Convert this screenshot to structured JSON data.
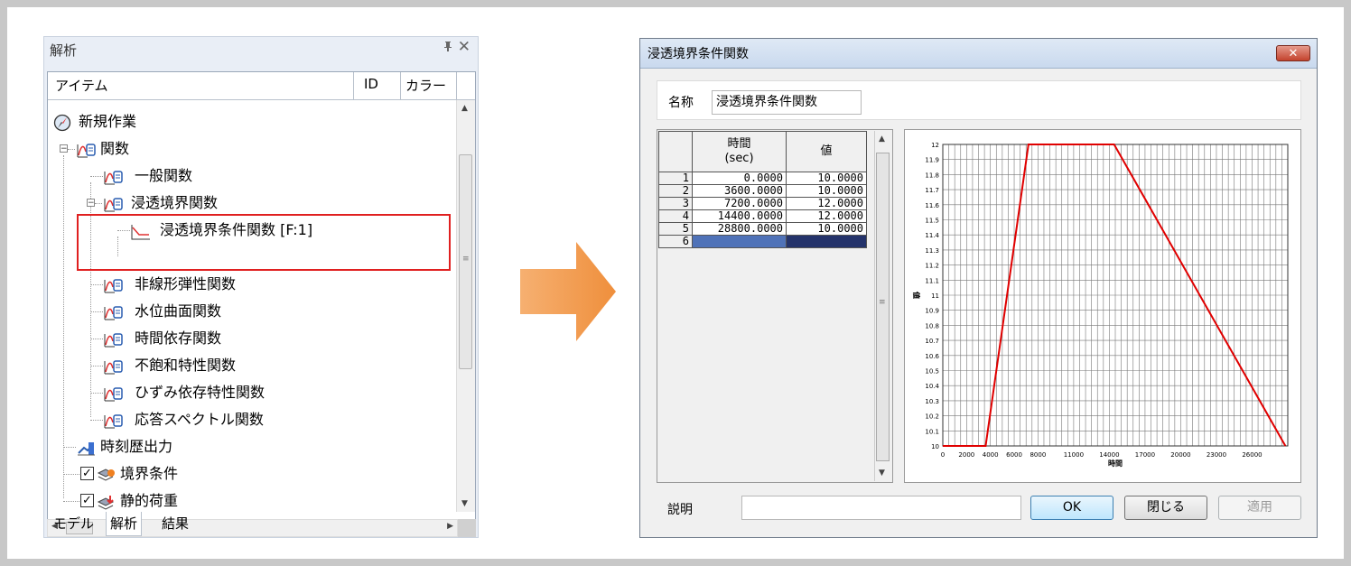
{
  "panel": {
    "title": "解析",
    "pin_glyph": "ᵖ",
    "close_glyph": "✕",
    "columns": {
      "item": "アイテム",
      "id": "ID",
      "color": "カラー"
    },
    "tree": [
      {
        "label": "新規作業",
        "icon": "compass-icon"
      },
      {
        "label": "関数",
        "icon": "function-folder-icon"
      },
      {
        "label": "一般関数",
        "icon": "function-folder-icon"
      },
      {
        "label": "浸透境界関数",
        "icon": "function-folder-icon"
      },
      {
        "label": "浸透境界条件関数 [F:1]",
        "icon": "line-graph-icon"
      },
      {
        "label": "非線形弾性関数",
        "icon": "function-folder-icon"
      },
      {
        "label": "水位曲面関数",
        "icon": "function-folder-icon"
      },
      {
        "label": "時間依存関数",
        "icon": "function-folder-icon"
      },
      {
        "label": "不飽和特性関数",
        "icon": "function-folder-icon"
      },
      {
        "label": "ひずみ依存特性関数",
        "icon": "function-folder-icon"
      },
      {
        "label": "応答スペクトル関数",
        "icon": "function-folder-icon"
      },
      {
        "label": "時刻歴出力",
        "icon": "history-output-icon"
      },
      {
        "label": "境界条件",
        "icon": "boundary-icon",
        "checked": true
      },
      {
        "label": "静的荷重",
        "icon": "static-load-icon",
        "checked": true
      }
    ],
    "tabs": [
      "モデル",
      "解析",
      "結果"
    ],
    "active_tab": "解析",
    "highlight_color": "#e02020"
  },
  "arrow": {
    "color": "#f0a050"
  },
  "dialog": {
    "title": "浸透境界条件関数",
    "close_glyph": "✕",
    "name_label": "名称",
    "name_value": "浸透境界条件関数",
    "table": {
      "col_time": "時間\n(sec)",
      "col_value": "値",
      "rows": [
        {
          "no": "1",
          "time": "0.0000",
          "value": "10.0000"
        },
        {
          "no": "2",
          "time": "3600.0000",
          "value": "10.0000"
        },
        {
          "no": "3",
          "time": "7200.0000",
          "value": "12.0000"
        },
        {
          "no": "4",
          "time": "14400.0000",
          "value": "12.0000"
        },
        {
          "no": "5",
          "time": "28800.0000",
          "value": "10.0000"
        },
        {
          "no": "6",
          "time": "",
          "value": ""
        }
      ]
    },
    "description_label": "説明",
    "buttons": {
      "ok": "OK",
      "close": "閉じる",
      "apply": "適用"
    }
  },
  "chart_data": {
    "type": "line",
    "title": "",
    "xlabel": "時間",
    "ylabel": "値",
    "xlim": [
      0,
      29000
    ],
    "ylim": [
      10,
      12
    ],
    "x_ticks": [
      "0",
      "2000",
      "4000",
      "6000",
      "8000",
      "11000",
      "14000",
      "17000",
      "20000",
      "23000",
      "26000"
    ],
    "x_tick_values": [
      0,
      2000,
      4000,
      6000,
      8000,
      11000,
      14000,
      17000,
      20000,
      23000,
      26000
    ],
    "y_ticks": [
      "10",
      "10.1",
      "10.2",
      "10.3",
      "10.4",
      "10.5",
      "10.6",
      "10.7",
      "10.8",
      "10.9",
      "11",
      "11.1",
      "11.2",
      "11.3",
      "11.4",
      "11.5",
      "11.6",
      "11.7",
      "11.8",
      "11.9",
      "12"
    ],
    "series": [
      {
        "x": [
          0,
          3600,
          7200,
          14400,
          28800
        ],
        "y": [
          10,
          10,
          12,
          12,
          10
        ],
        "color": "#e00000"
      }
    ],
    "grid": true
  }
}
